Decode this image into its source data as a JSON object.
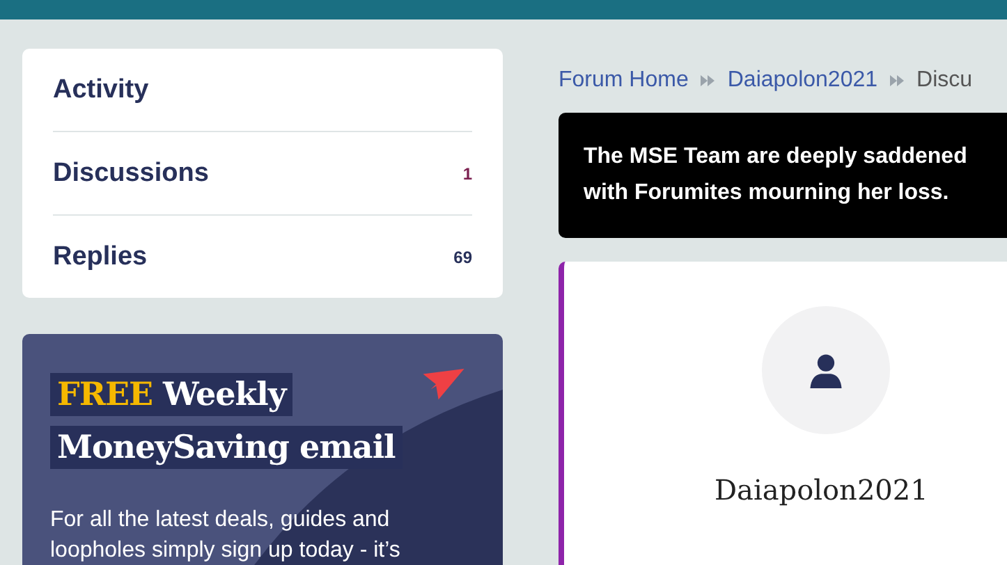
{
  "profile_nav": {
    "items": [
      {
        "label": "Activity"
      },
      {
        "label": "Discussions",
        "count": "1"
      },
      {
        "label": "Replies",
        "count": "69"
      }
    ]
  },
  "promo": {
    "heading_highlight": "FREE",
    "heading_rest": "Weekly",
    "heading_line_2": "MoneySaving email",
    "body": "For all the latest deals, guides and loopholes simply sign up today - it’s"
  },
  "breadcrumb": [
    {
      "label": "Forum Home",
      "kind": "link"
    },
    {
      "label": "Daiapolon2021",
      "kind": "link"
    },
    {
      "label": "Discu",
      "kind": "current"
    }
  ],
  "notice": {
    "lines": [
      "The MSE Team are deeply saddened",
      "with Forumites mourning her loss."
    ]
  },
  "profile": {
    "username": "Daiapolon2021"
  }
}
